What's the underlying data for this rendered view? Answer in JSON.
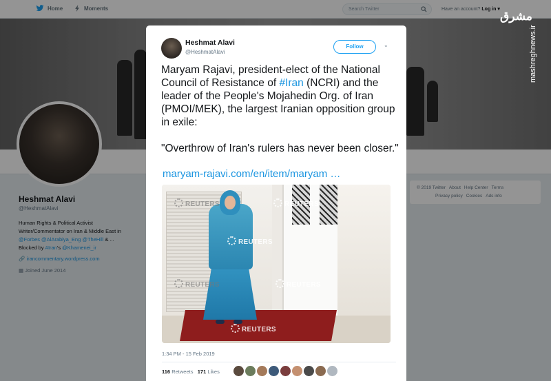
{
  "nav": {
    "home_label": "Home",
    "moments_label": "Moments",
    "search_placeholder": "Search Twitter",
    "have_account": "Have an account?",
    "login_label": "Log in"
  },
  "profile": {
    "name": "Heshmat Alavi",
    "handle": "@HeshmatAlavi",
    "bio_line1": "Human Rights & Political Activist",
    "bio_line2": "Writer/Commentator on Iran & Middle East in",
    "bio_line3_links": "@Forbes @AlArabiya_Eng @TheHill",
    "bio_line3_tail": " & ...",
    "bio_line4_prefix": "Blocked by ",
    "bio_line4_link1": "#Iran",
    "bio_line4_mid": "'s ",
    "bio_line4_link2": "@Khamenei_ir",
    "website": "irancommentary.wordpress.com",
    "joined": "Joined June 2014"
  },
  "footer": {
    "line1": [
      "© 2019 Twitter",
      "About",
      "Help Center",
      "Terms"
    ],
    "line2": [
      "Privacy policy",
      "Cookies",
      "Ads info"
    ]
  },
  "watermark": {
    "logo": "مشرق",
    "url": "mashreghnews.ir"
  },
  "tweet": {
    "author_name": "Heshmat Alavi",
    "author_handle": "@HeshmatAlavi",
    "follow_label": "Follow",
    "text_part1": "Maryam Rajavi, president-elect of the National Council of Resistance of ",
    "text_hashtag": "#Iran",
    "text_part2": " (NCRI) and the leader of the People's Mojahedin Org. of Iran (PMOI/MEK), the largest Iranian opposition group in exile:",
    "quote": "\"Overthrow of Iran's rulers has never been closer.\"",
    "link": "maryam-rajavi.com/en/item/maryam …",
    "photo_watermark": "REUTERS",
    "timestamp": "1:34 PM - 15 Feb 2019",
    "retweets_count": "116",
    "retweets_label": "Retweets",
    "likes_count": "171",
    "likes_label": "Likes"
  },
  "colors": {
    "accent": "#1da1f2",
    "link": "#1b95e0",
    "text": "#14171a",
    "muted": "#657786",
    "background": "#e6ecf0"
  }
}
